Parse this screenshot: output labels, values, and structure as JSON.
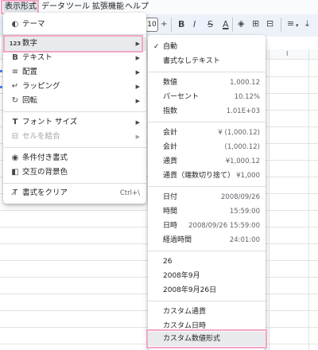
{
  "menubar": {
    "items": [
      "表示形式",
      "データ",
      "ツール",
      "拡張機能",
      "ヘルプ"
    ]
  },
  "toolbar": {
    "font_size": "10",
    "bold": "B",
    "italic": "I",
    "strike": "S",
    "text_color": "A"
  },
  "sheet": {
    "column_header": "I"
  },
  "format_menu": {
    "items": [
      {
        "icon": "palette-icon",
        "label": "テーマ"
      },
      {
        "icon": "number-icon",
        "label": "数字",
        "glyph": "123"
      },
      {
        "icon": "bold-icon",
        "label": "テキスト"
      },
      {
        "icon": "align-icon",
        "label": "配置"
      },
      {
        "icon": "wrap-icon",
        "label": "ラッピング"
      },
      {
        "icon": "rotate-icon",
        "label": "回転"
      },
      {
        "icon": "font-size-icon",
        "label": "フォント サイズ"
      },
      {
        "icon": "merge-icon",
        "label": "セルを結合"
      },
      {
        "icon": "conditional-format-icon",
        "label": "条件付き書式"
      },
      {
        "icon": "alternating-colors-icon",
        "label": "交互の背景色"
      },
      {
        "icon": "clear-format-icon",
        "label": "書式をクリア",
        "shortcut": "Ctrl+\\"
      }
    ]
  },
  "number_submenu": {
    "items": [
      {
        "label": "自動",
        "checked": "✓"
      },
      {
        "label": "書式なしテキスト"
      },
      {
        "label": "数値",
        "value": "1,000.12"
      },
      {
        "label": "パーセント",
        "value": "10.12%"
      },
      {
        "label": "指数",
        "value": "1.01E+03"
      },
      {
        "label": "会計",
        "value": "¥ (1,000.12)"
      },
      {
        "label": "会計",
        "value": "(1,000.12)"
      },
      {
        "label": "通貨",
        "value": "¥1,000.12"
      },
      {
        "label": "通貨（端数切り捨て）",
        "value": "¥1,000"
      },
      {
        "label": "日付",
        "value": "2008/09/26"
      },
      {
        "label": "時間",
        "value": "15:59:00"
      },
      {
        "label": "日時",
        "value": "2008/09/26 15:59:00"
      },
      {
        "label": "経過時間",
        "value": "24:01:00"
      },
      {
        "label": "26"
      },
      {
        "label": "2008年9月"
      },
      {
        "label": "2008年9月26日"
      },
      {
        "label": "カスタム通貨"
      },
      {
        "label": "カスタム日時"
      },
      {
        "label": "カスタム数値形式"
      }
    ]
  },
  "colors": {
    "highlight": "#f2a7c4",
    "menu_hover": "#e8eaed"
  }
}
